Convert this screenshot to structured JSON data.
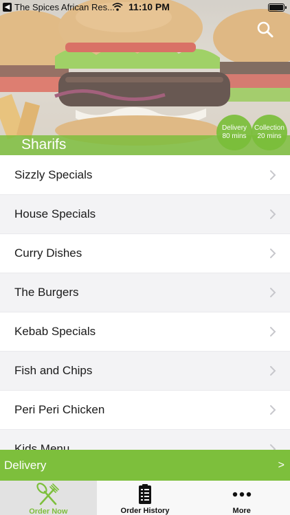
{
  "status_bar": {
    "back_glyph": "◀",
    "app_name": "The Spices African Res...",
    "time": "11:10 PM"
  },
  "hero": {
    "restaurant_name": "Sharifs",
    "delivery_badge": {
      "label": "Delivery",
      "time": "80 mins"
    },
    "collection_badge": {
      "label": "Collection",
      "time": "20 mins"
    }
  },
  "menu": {
    "items": [
      {
        "label": "Sizzly Specials"
      },
      {
        "label": "House Specials"
      },
      {
        "label": "Curry Dishes"
      },
      {
        "label": "The Burgers"
      },
      {
        "label": "Kebab Specials"
      },
      {
        "label": "Fish and Chips"
      },
      {
        "label": "Peri Peri Chicken"
      },
      {
        "label": "Kids Menu"
      }
    ]
  },
  "delivery_bar": {
    "label": "Delivery",
    "arrow": ">"
  },
  "tabs": [
    {
      "label": "Order Now",
      "icon": "fork-knife-icon",
      "active": true
    },
    {
      "label": "Order History",
      "icon": "receipt-icon",
      "active": false
    },
    {
      "label": "More",
      "icon": "more-dots-icon",
      "active": false
    }
  ],
  "colors": {
    "accent_green": "#7dbf3c",
    "row_alt": "#f3f3f5",
    "tab_active_bg": "#e2e2e2"
  }
}
